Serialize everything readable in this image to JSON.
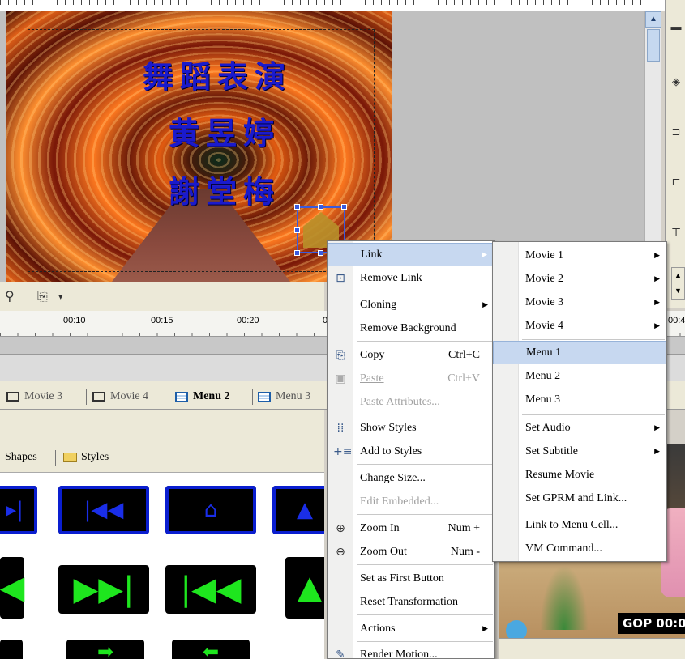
{
  "preview": {
    "title_lines": [
      "舞蹈表演",
      "黄昱婷",
      "謝堂梅"
    ]
  },
  "toolbar": {
    "zoom_icon": "magnifier-icon",
    "copy_icon": "copy-icon",
    "dropdown_glyph": "▾"
  },
  "timeline": {
    "ticks": [
      "00:10",
      "00:15",
      "00:20",
      "0",
      "00:4"
    ]
  },
  "tabs": [
    {
      "label": "Movie 3",
      "active": false
    },
    {
      "label": "Movie 4",
      "active": false
    },
    {
      "label": "Menu 2",
      "active": true
    },
    {
      "label": "Menu 3",
      "active": false
    }
  ],
  "library_tabs": [
    "Shapes",
    "Styles"
  ],
  "context_menu": {
    "items": [
      {
        "label": "Link",
        "submenu": true
      },
      {
        "label": "Remove Link"
      },
      {
        "label": "Cloning",
        "submenu": true
      },
      {
        "label": "Remove Background"
      },
      {
        "label": "Copy",
        "shortcut": "Ctrl+C"
      },
      {
        "label": "Paste",
        "shortcut": "Ctrl+V",
        "disabled": true
      },
      {
        "label": "Paste Attributes...",
        "disabled": true
      },
      {
        "label": "Show Styles"
      },
      {
        "label": "Add to Styles"
      },
      {
        "label": "Change Size..."
      },
      {
        "label": "Edit Embedded...",
        "disabled": true
      },
      {
        "label": "Zoom In",
        "shortcut": "Num +"
      },
      {
        "label": "Zoom Out",
        "shortcut": "Num -"
      },
      {
        "label": "Set as First Button"
      },
      {
        "label": "Reset Transformation"
      },
      {
        "label": "Actions",
        "submenu": true
      },
      {
        "label": "Render Motion..."
      }
    ]
  },
  "link_submenu": {
    "items": [
      {
        "label": "Movie 1",
        "submenu": true
      },
      {
        "label": "Movie 2",
        "submenu": true
      },
      {
        "label": "Movie 3",
        "submenu": true
      },
      {
        "label": "Movie 4",
        "submenu": true
      },
      {
        "label": "Menu 1",
        "highlighted": true
      },
      {
        "label": "Menu 2"
      },
      {
        "label": "Menu 3"
      },
      {
        "label": "Set Audio",
        "submenu": true
      },
      {
        "label": "Set Subtitle",
        "submenu": true
      },
      {
        "label": "Resume Movie"
      },
      {
        "label": "Set GPRM and Link..."
      },
      {
        "label": "Link to Menu Cell..."
      },
      {
        "label": "VM Command..."
      }
    ]
  },
  "video": {
    "gop_label": "GOP 00:0"
  },
  "colors": {
    "menu_highlight": "#c7d8f0",
    "button_blue": "#0a1ed0",
    "button_green": "#1ee61e",
    "title_blue": "#1a1acc"
  }
}
